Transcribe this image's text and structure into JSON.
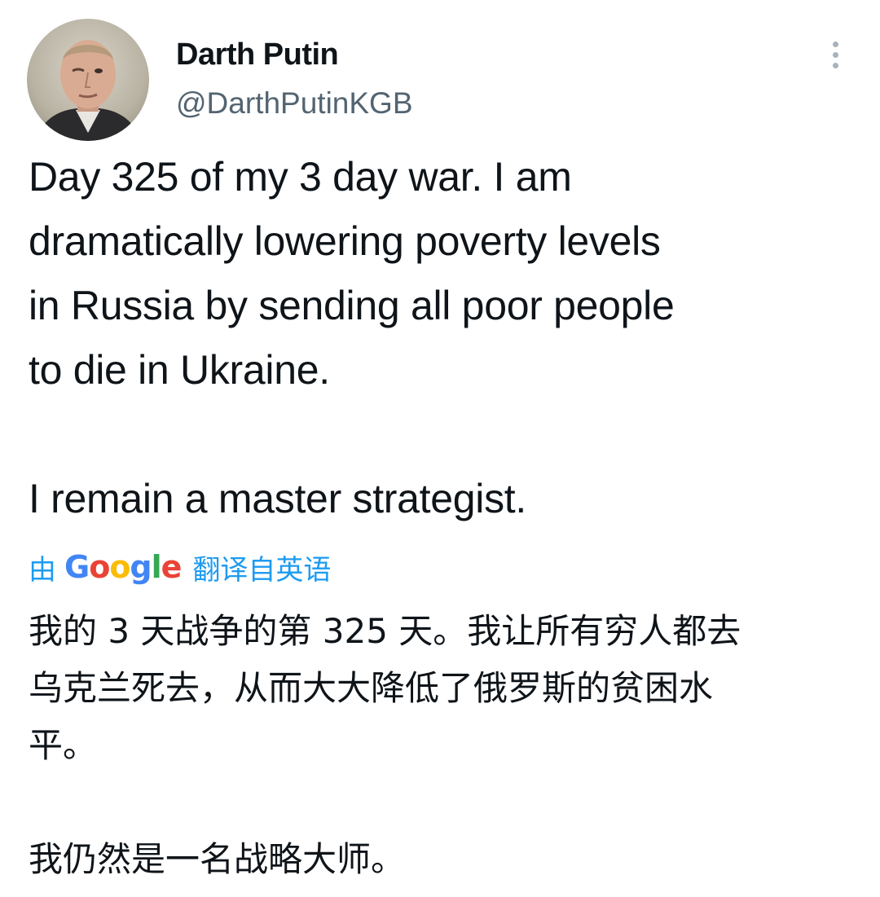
{
  "author": {
    "display_name": "Darth Putin",
    "handle": "@DarthPutinKGB",
    "avatar_icon": "avatar-photo"
  },
  "menu": {
    "more_icon": "more-vertical-icon"
  },
  "tweet": {
    "lines": [
      "Day 325 of my 3 day war. I am",
      "dramatically lowering poverty levels",
      "in Russia by sending all poor people",
      "to die in Ukraine.",
      "I remain a master strategist."
    ]
  },
  "translation": {
    "by_label": "由",
    "google_letters": [
      {
        "ch": "G",
        "color": "#4285F4"
      },
      {
        "ch": "o",
        "color": "#EA4335"
      },
      {
        "ch": "o",
        "color": "#FBBC05"
      },
      {
        "ch": "g",
        "color": "#4285F4"
      },
      {
        "ch": "l",
        "color": "#34A853"
      },
      {
        "ch": "e",
        "color": "#EA4335"
      }
    ],
    "google_label": "Google",
    "from_label": "翻译自英语",
    "lines": [
      "我的 3 天战争的第 325 天。我让所有穷人都去",
      "乌克兰死去，从而大大降低了俄罗斯的贫困水",
      "平。",
      "我仍然是一名战略大师。"
    ]
  },
  "colors": {
    "text": "#0f1419",
    "secondary": "#536471",
    "link": "#1d9bf0"
  }
}
